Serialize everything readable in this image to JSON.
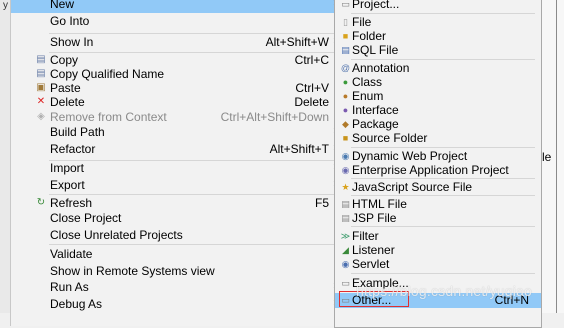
{
  "background": {
    "left_mark": "y",
    "right_fragment": "le"
  },
  "context_menu": {
    "items": [
      {
        "label": "New",
        "shortcut": "",
        "submenu": true,
        "icon": "none",
        "disabled": false,
        "highlighted": true
      },
      {
        "label": "Go Into",
        "shortcut": "",
        "submenu": false,
        "icon": "none",
        "disabled": false
      },
      {
        "label": "Show In",
        "shortcut": "Alt+Shift+W",
        "submenu": true,
        "icon": "none",
        "disabled": false
      },
      {
        "label": "Copy",
        "shortcut": "Ctrl+C",
        "submenu": false,
        "icon": "copy-icon",
        "disabled": false
      },
      {
        "label": "Copy Qualified Name",
        "shortcut": "",
        "submenu": false,
        "icon": "copy-qualified-name-icon",
        "disabled": false
      },
      {
        "label": "Paste",
        "shortcut": "Ctrl+V",
        "submenu": false,
        "icon": "paste-icon",
        "disabled": false
      },
      {
        "label": "Delete",
        "shortcut": "Delete",
        "submenu": false,
        "icon": "delete-icon",
        "disabled": false
      },
      {
        "label": "Remove from Context",
        "shortcut": "Ctrl+Alt+Shift+Down",
        "submenu": false,
        "icon": "remove-from-context-icon",
        "disabled": true
      },
      {
        "label": "Build Path",
        "shortcut": "",
        "submenu": true,
        "icon": "none",
        "disabled": false
      },
      {
        "label": "Refactor",
        "shortcut": "Alt+Shift+T",
        "submenu": true,
        "icon": "none",
        "disabled": false
      },
      {
        "label": "Import",
        "shortcut": "",
        "submenu": true,
        "icon": "none",
        "disabled": false
      },
      {
        "label": "Export",
        "shortcut": "",
        "submenu": true,
        "icon": "none",
        "disabled": false
      },
      {
        "label": "Refresh",
        "shortcut": "F5",
        "submenu": false,
        "icon": "refresh-icon",
        "disabled": false
      },
      {
        "label": "Close Project",
        "shortcut": "",
        "submenu": false,
        "icon": "none",
        "disabled": false
      },
      {
        "label": "Close Unrelated Projects",
        "shortcut": "",
        "submenu": false,
        "icon": "none",
        "disabled": false
      },
      {
        "label": "Validate",
        "shortcut": "",
        "submenu": false,
        "icon": "none",
        "disabled": false
      },
      {
        "label": "Show in Remote Systems view",
        "shortcut": "",
        "submenu": false,
        "icon": "none",
        "disabled": false
      },
      {
        "label": "Run As",
        "shortcut": "",
        "submenu": true,
        "icon": "none",
        "disabled": false
      },
      {
        "label": "Debug As",
        "shortcut": "",
        "submenu": true,
        "icon": "none",
        "disabled": false
      }
    ]
  },
  "submenu_new": {
    "items": [
      {
        "label": "Project...",
        "icon": "project-icon",
        "shortcut": ""
      },
      {
        "label": "File",
        "icon": "file-icon",
        "shortcut": ""
      },
      {
        "label": "Folder",
        "icon": "folder-icon",
        "shortcut": ""
      },
      {
        "label": "SQL File",
        "icon": "sql-file-icon",
        "shortcut": ""
      },
      {
        "label": "Annotation",
        "icon": "annotation-icon",
        "shortcut": ""
      },
      {
        "label": "Class",
        "icon": "class-icon",
        "shortcut": ""
      },
      {
        "label": "Enum",
        "icon": "enum-icon",
        "shortcut": ""
      },
      {
        "label": "Interface",
        "icon": "interface-icon",
        "shortcut": ""
      },
      {
        "label": "Package",
        "icon": "package-icon",
        "shortcut": ""
      },
      {
        "label": "Source Folder",
        "icon": "source-folder-icon",
        "shortcut": ""
      },
      {
        "label": "Dynamic Web Project",
        "icon": "dynamic-web-project-icon",
        "shortcut": ""
      },
      {
        "label": "Enterprise Application Project",
        "icon": "enterprise-application-project-icon",
        "shortcut": ""
      },
      {
        "label": "JavaScript Source File",
        "icon": "javascript-source-file-icon",
        "shortcut": ""
      },
      {
        "label": "HTML File",
        "icon": "html-file-icon",
        "shortcut": ""
      },
      {
        "label": "JSP File",
        "icon": "jsp-file-icon",
        "shortcut": ""
      },
      {
        "label": "Filter",
        "icon": "filter-icon",
        "shortcut": ""
      },
      {
        "label": "Listener",
        "icon": "listener-icon",
        "shortcut": ""
      },
      {
        "label": "Servlet",
        "icon": "servlet-icon",
        "shortcut": ""
      },
      {
        "label": "Example...",
        "icon": "example-icon",
        "shortcut": ""
      },
      {
        "label": "Other...",
        "icon": "other-icon",
        "shortcut": "Ctrl+N",
        "highlighted": true
      }
    ]
  },
  "watermark": "https://blog.csdn.net/yuqiao",
  "colors": {
    "highlight": "#91c9f7",
    "menu_bg": "#f2f2f2",
    "annotation_box": "#e03030",
    "disabled_text": "#8a8a8a"
  }
}
